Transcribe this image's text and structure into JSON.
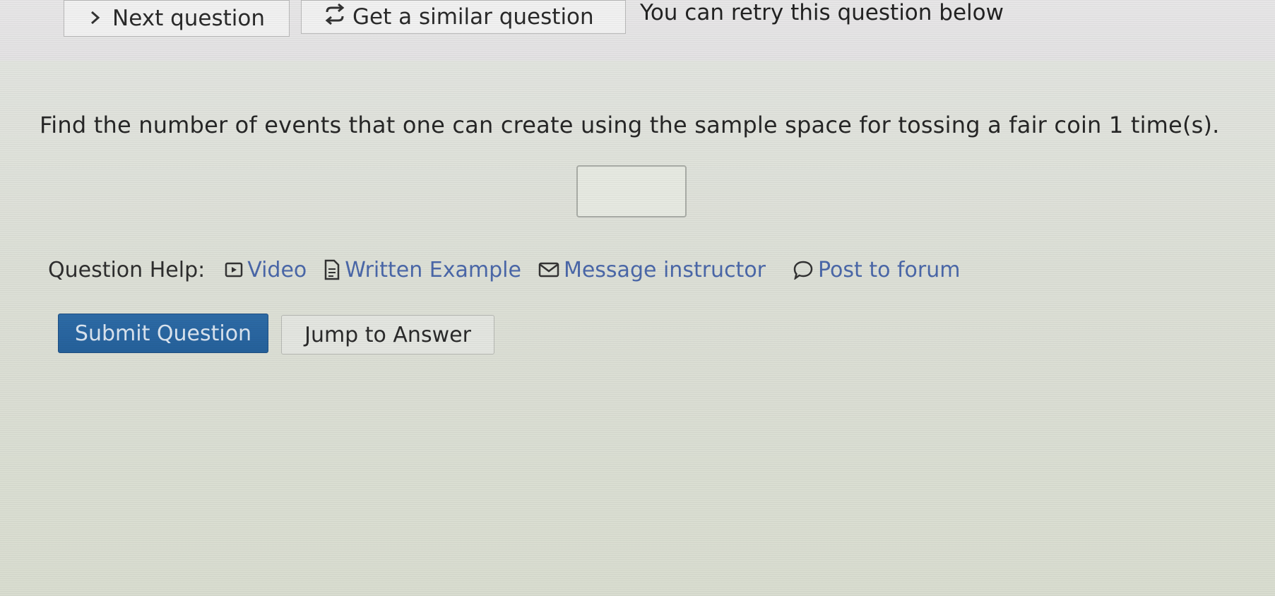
{
  "toolbar": {
    "next_label": "Next question",
    "similar_label": "Get a similar question",
    "retry_note": "You can retry this question below"
  },
  "question": {
    "text": "Find the number of events that one can create using the sample space for tossing a fair coin 1 time(s).",
    "answer_value": ""
  },
  "help": {
    "label": "Question Help:",
    "links": [
      {
        "label": "Video",
        "icon": "video-icon"
      },
      {
        "label": "Written Example",
        "icon": "document-icon"
      },
      {
        "label": "Message instructor",
        "icon": "envelope-icon"
      },
      {
        "label": "Post to forum",
        "icon": "speech-bubble-icon"
      }
    ]
  },
  "actions": {
    "submit_label": "Submit Question",
    "jump_label": "Jump to Answer"
  },
  "colors": {
    "link": "#4a67a8",
    "primary_button": "#2a67a2"
  }
}
